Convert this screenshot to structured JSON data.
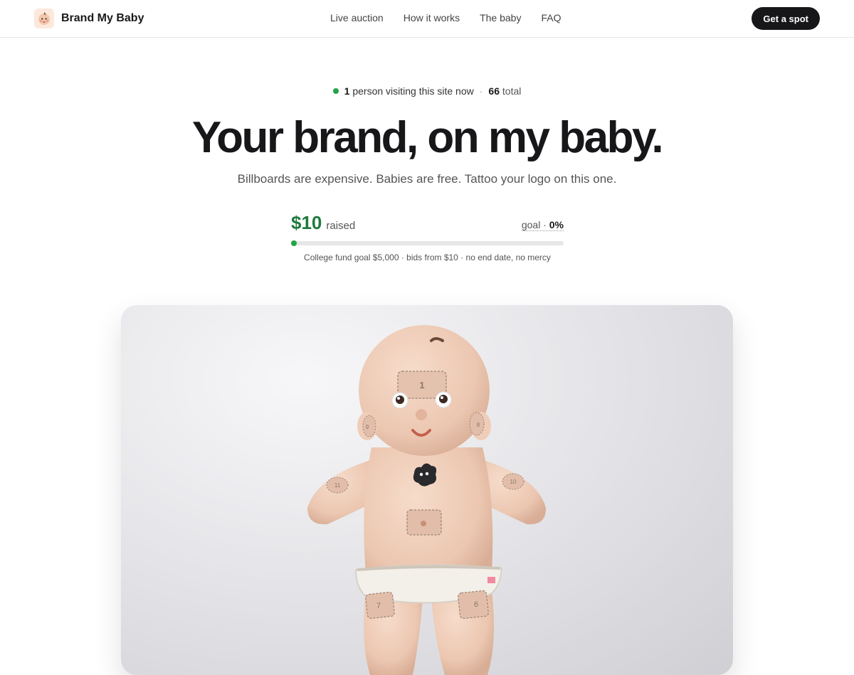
{
  "header": {
    "brand_name": "Brand My Baby",
    "nav": [
      "Live auction",
      "How it works",
      "The baby",
      "FAQ"
    ],
    "cta_label": "Get a spot"
  },
  "visitors": {
    "count": "1",
    "text": "person visiting this site now",
    "total_count": "66",
    "total_label": "total"
  },
  "hero": {
    "title": "Your brand, on my baby.",
    "subtitle": "Billboards are expensive. Babies are free. Tattoo your logo on this one."
  },
  "progress": {
    "amount": "$10",
    "raised_label": "raised",
    "goal_label": "goal ·",
    "goal_percent": "0%",
    "fill_fraction": 0.002,
    "caption": "College fund goal $5,000 · bids from $10 · no end date, no mercy"
  },
  "baby": {
    "spots": [
      "1",
      "6",
      "7",
      "8",
      "9",
      "10",
      "11"
    ]
  },
  "colors": {
    "accent_green": "#22a447",
    "amount_green": "#1e7a3c",
    "cta_dark": "#17171a",
    "skin": "#efcfbd"
  }
}
